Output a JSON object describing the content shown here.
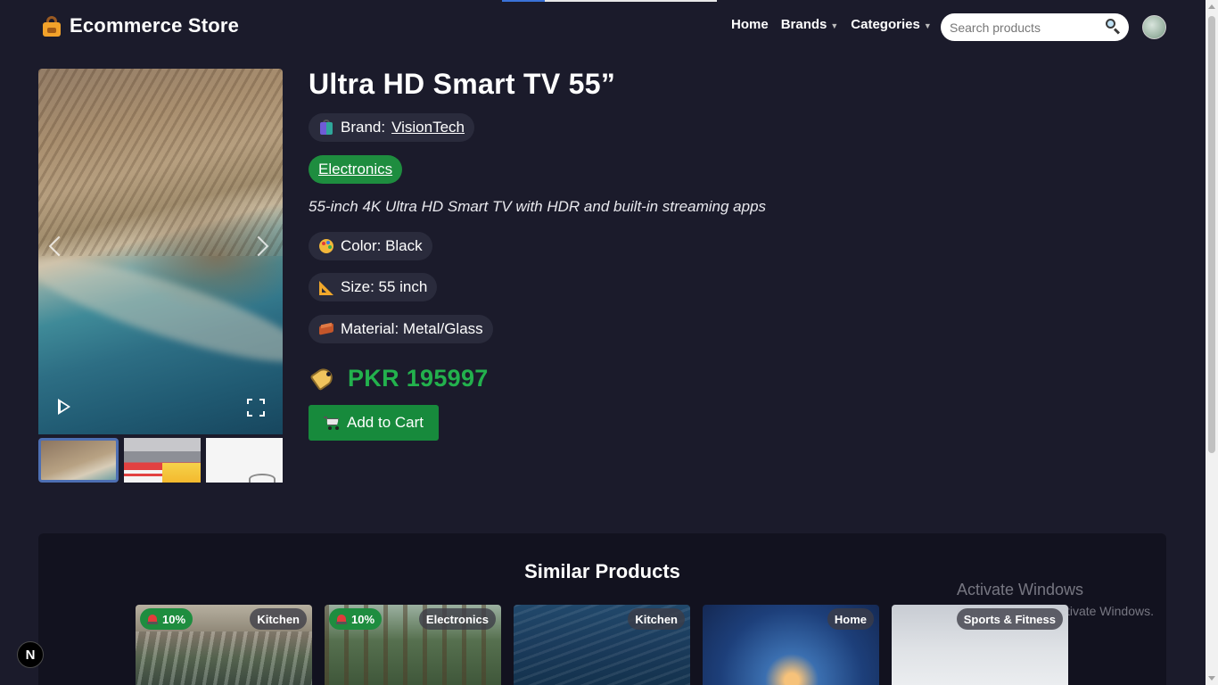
{
  "header": {
    "brand": "Ecommerce Store",
    "nav": [
      {
        "label": "Home"
      },
      {
        "label": "Brands"
      },
      {
        "label": "Categories"
      }
    ],
    "search_placeholder": "Search products",
    "progress": 0.2
  },
  "product": {
    "title": "Ultra HD Smart TV 55”",
    "brand_label": "Brand:",
    "brand_name": "VisionTech",
    "category": "Electronics",
    "description": "55-inch 4K Ultra HD Smart TV with HDR and built-in streaming apps",
    "attributes": {
      "color": "Color: Black",
      "size": "Size: 55 inch",
      "material": "Material: Metal/Glass"
    },
    "price": "PKR 195997",
    "add_to_cart": "Add to Cart"
  },
  "similar": {
    "title": "Similar Products",
    "cards": [
      {
        "discount": "10%",
        "category": "Kitchen"
      },
      {
        "discount": "10%",
        "category": "Electronics"
      },
      {
        "discount": "",
        "category": "Kitchen"
      },
      {
        "discount": "",
        "category": "Home"
      },
      {
        "discount": "",
        "category": "Sports & Fitness"
      }
    ]
  },
  "watermark": {
    "line1": "Activate Windows",
    "line2": "Go to Settings to activate Windows."
  },
  "dev_badge": "N",
  "colors": {
    "background": "#1b1b2b",
    "accent_green": "#1e8d3f",
    "price_green": "#23b14d",
    "pill_bg": "#2a2b3c"
  }
}
